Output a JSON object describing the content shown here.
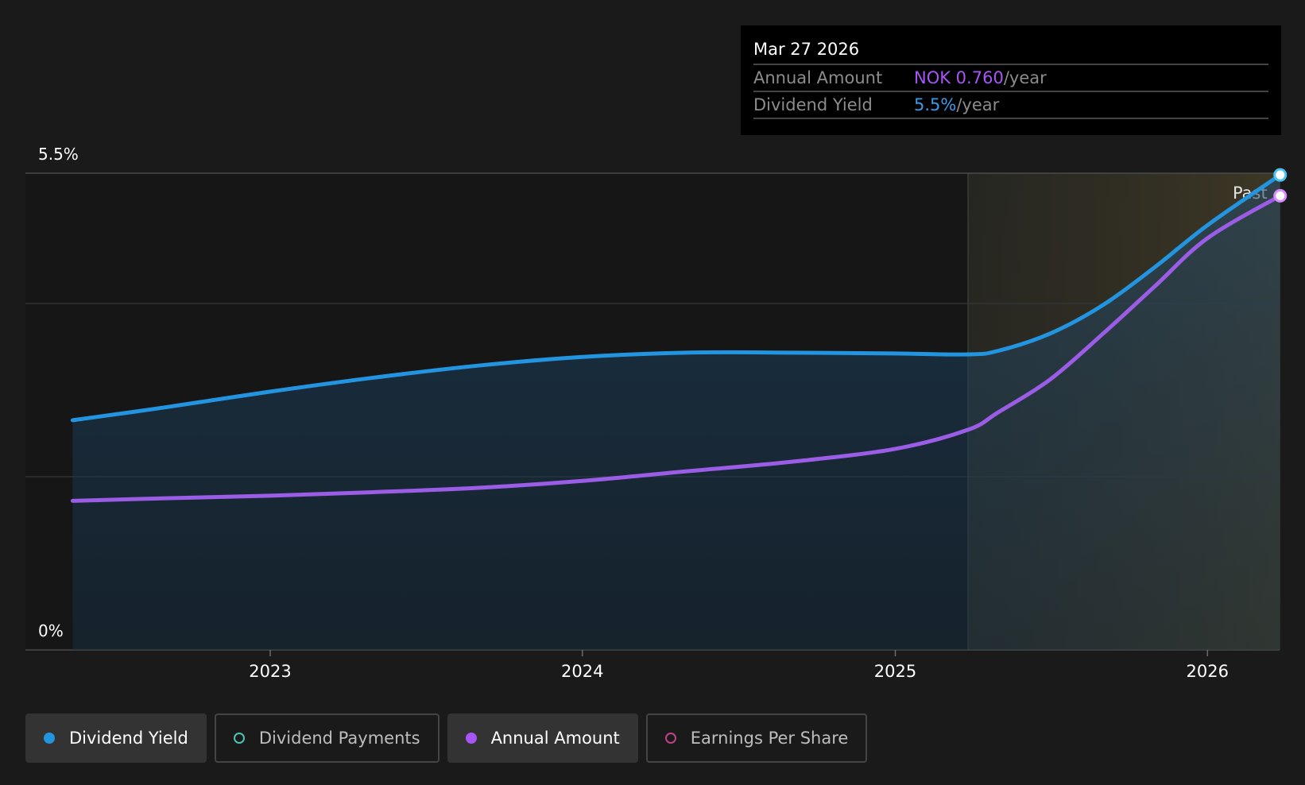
{
  "tooltip": {
    "date": "Mar 27 2026",
    "amount_label": "Annual Amount",
    "amount_value": "NOK 0.760",
    "amount_unit": "/year",
    "yield_label": "Dividend Yield",
    "yield_value": "5.5%",
    "yield_unit": "/year"
  },
  "past_label": "Past",
  "legend": [
    {
      "label": "Dividend Yield",
      "color": "#2394df",
      "active": true
    },
    {
      "label": "Dividend Payments",
      "color": "#49c5b6",
      "active": false
    },
    {
      "label": "Annual Amount",
      "color": "#a855f7",
      "active": true
    },
    {
      "label": "Earnings Per Share",
      "color": "#c2418a",
      "active": false
    }
  ],
  "colors": {
    "yield": "#2394df",
    "amount": "#9b5de5",
    "past_region": "#3a2e1a"
  },
  "chart_data": {
    "type": "line",
    "x_ticks": [
      "2023",
      "2024",
      "2025",
      "2026"
    ],
    "y_tick_labels": [
      "0%",
      "5.5%"
    ],
    "ylim": [
      0,
      5.5
    ],
    "xlim": [
      "2022-05-15",
      "2026-03-27"
    ],
    "past_start": "2025-03-27",
    "series": [
      {
        "name": "Dividend Yield",
        "x": [
          "2022-05-15",
          "2022-09-01",
          "2023-01-01",
          "2023-05-01",
          "2023-09-01",
          "2024-01-01",
          "2024-05-01",
          "2024-09-01",
          "2025-01-01",
          "2025-03-27",
          "2025-05-01",
          "2025-07-01",
          "2025-09-01",
          "2025-11-01",
          "2026-01-01",
          "2026-03-27"
        ],
        "values": [
          2.65,
          2.8,
          2.98,
          3.14,
          3.28,
          3.38,
          3.43,
          3.43,
          3.42,
          3.41,
          3.45,
          3.65,
          3.98,
          4.42,
          4.9,
          5.48
        ]
      },
      {
        "name": "Annual Amount",
        "x": [
          "2022-05-15",
          "2022-09-01",
          "2023-01-01",
          "2023-05-01",
          "2023-09-01",
          "2024-01-01",
          "2024-05-01",
          "2024-09-01",
          "2025-01-01",
          "2025-03-27",
          "2025-05-01",
          "2025-07-01",
          "2025-09-01",
          "2025-11-01",
          "2026-01-01",
          "2026-03-27"
        ],
        "values": [
          1.72,
          1.75,
          1.78,
          1.82,
          1.87,
          1.95,
          2.06,
          2.17,
          2.32,
          2.54,
          2.74,
          3.12,
          3.65,
          4.2,
          4.75,
          5.24
        ]
      }
    ]
  }
}
